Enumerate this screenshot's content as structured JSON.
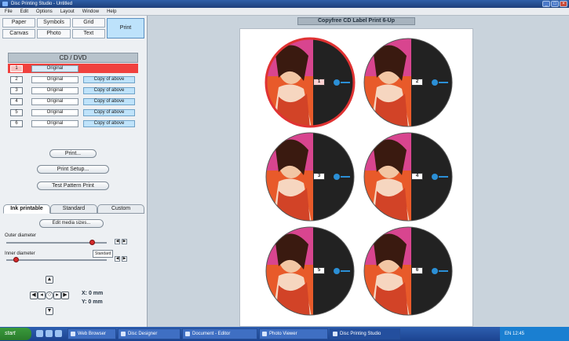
{
  "window": {
    "title": "Disc Printing Studio - Untitled"
  },
  "menu": [
    "File",
    "Edit",
    "Options",
    "Layout",
    "Window",
    "Help"
  ],
  "tabs": [
    "Paper",
    "Symbols",
    "Grid",
    "Canvas",
    "Photo",
    "Text"
  ],
  "print_tab": "Print",
  "cd_panel": {
    "title": "CD / DVD",
    "rows": [
      {
        "num": "1",
        "original": "Original",
        "copy": ""
      },
      {
        "num": "2",
        "original": "Original",
        "copy": "Copy of above"
      },
      {
        "num": "3",
        "original": "Original",
        "copy": "Copy of above"
      },
      {
        "num": "4",
        "original": "Original",
        "copy": "Copy of above"
      },
      {
        "num": "5",
        "original": "Original",
        "copy": "Copy of above"
      },
      {
        "num": "6",
        "original": "Original",
        "copy": "Copy of above"
      }
    ]
  },
  "buttons": {
    "print": "Print...",
    "print_setup": "Print Setup...",
    "test_pattern": "Test Pattern Print"
  },
  "print_tabs": [
    "Ink printable",
    "Standard",
    "Custom"
  ],
  "settings": {
    "edit_button": "Edit media sizes...",
    "outer_label": "Outer diameter",
    "inner_label": "Inner diameter",
    "inner_flag": "Standard",
    "outer_value": 0.86,
    "inner_value": 0.1
  },
  "position": {
    "x": "X: 0 mm",
    "y": "Y: 0 mm"
  },
  "canvas": {
    "title": "Copyfree CD Label Print 6-Up"
  },
  "discs": [
    {
      "num": "1",
      "selected": true
    },
    {
      "num": "2",
      "selected": false
    },
    {
      "num": "3",
      "selected": false
    },
    {
      "num": "4",
      "selected": false
    },
    {
      "num": "5",
      "selected": false
    },
    {
      "num": "6",
      "selected": false
    }
  ],
  "taskbar": {
    "start": "start",
    "items": [
      "Web Browser",
      "Disc Designer",
      "Document - Editor",
      "Photo Viewer",
      "Disc Printing Studio"
    ],
    "clock": "EN 12:45"
  },
  "colors": {
    "accent": "#bde2fb",
    "selected_row": "#f0413e",
    "disc_dark": "#222222",
    "disc_accent": "#d8458f"
  }
}
